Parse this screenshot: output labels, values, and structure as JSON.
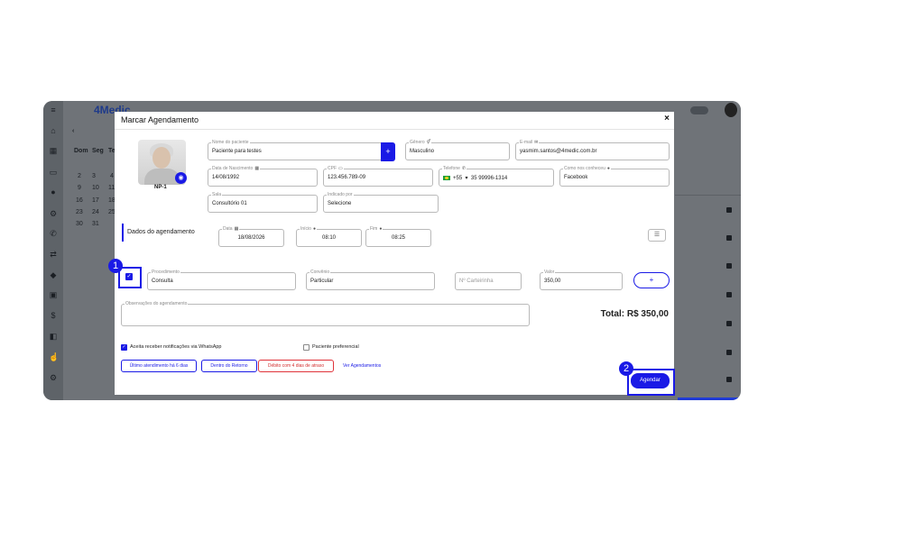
{
  "app": {
    "logo": "4Medic",
    "calendar": {
      "weekdays": [
        "Dom",
        "Seg",
        "Te"
      ],
      "rows": [
        [
          "2",
          "3",
          "4"
        ],
        [
          "9",
          "10",
          "11"
        ],
        [
          "16",
          "17",
          "18"
        ],
        [
          "23",
          "24",
          "25"
        ],
        [
          "30",
          "31",
          ""
        ]
      ]
    }
  },
  "modal": {
    "title": "Marcar Agendamento",
    "close": "×",
    "patient_code": "NP-1",
    "fields": {
      "nome": {
        "label": "Nome do paciente",
        "value": "Paciente para testes"
      },
      "genero": {
        "label": "Gênero",
        "value": "Masculino"
      },
      "email": {
        "label": "E-mail",
        "value": "yasmim.santos@4medic.com.br"
      },
      "nascimento": {
        "label": "Data de Nascimento",
        "value": "14/08/1992"
      },
      "cpf": {
        "label": "CPF",
        "value": "123.456.789-09"
      },
      "telefone": {
        "label": "Telefone",
        "ddi": "+55",
        "value": "35 99996-1314"
      },
      "como_conheceu": {
        "label": "Como nos conheceu",
        "value": "Facebook"
      },
      "sala": {
        "label": "Sala",
        "value": "Consultório 01"
      },
      "indicado_por": {
        "label": "Indicado por",
        "value": "Selecione"
      },
      "data": {
        "label": "Data",
        "value": "18/08/2026"
      },
      "inicio": {
        "label": "Início",
        "value": "08:10"
      },
      "fim": {
        "label": "Fim",
        "value": "08:25"
      },
      "procedimento": {
        "label": "Procedimento",
        "value": "Consulta"
      },
      "convenio": {
        "label": "Convênio",
        "value": "Particular"
      },
      "carteirinha": {
        "placeholder": "Nº Carteirinha"
      },
      "valor": {
        "label": "Valor",
        "value": "350,00"
      },
      "observacoes": {
        "label": "Observações do agendamento"
      }
    },
    "section_title": "Dados do agendamento",
    "add_label": "+",
    "total_label": "Total:",
    "total_value": "R$ 350,00",
    "whatsapp_label": "Aceita receber notificações via WhatsApp",
    "preferencial_label": "Paciente preferencial",
    "chips": {
      "ultimo": "Último atendimento há 6 dias",
      "retorno": "Dentro do Retorno",
      "debito": "Débito com 4 dias de atraso"
    },
    "ver_agendamentos": "Ver Agendamentos",
    "schedule_button": "Agendar"
  },
  "annotations": {
    "step1": "1",
    "step2": "2"
  },
  "colors": {
    "accent": "#1a1ae6",
    "danger": "#e0333a",
    "overlay": "#6f7378"
  }
}
